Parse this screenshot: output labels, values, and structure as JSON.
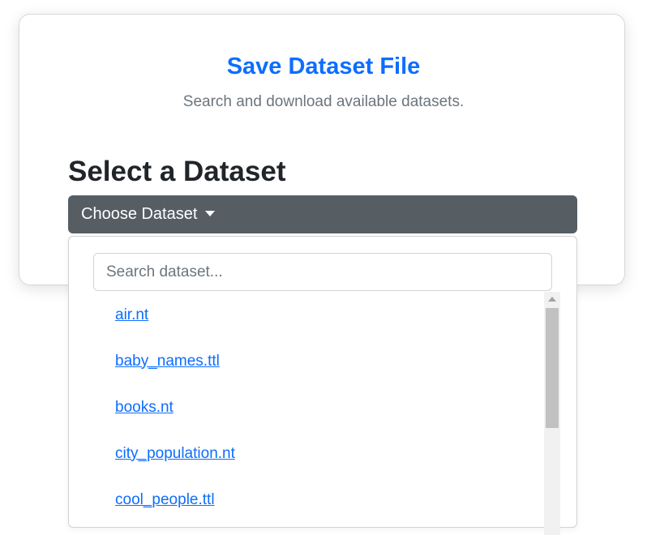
{
  "header": {
    "title": "Save Dataset File",
    "subtitle": "Search and download available datasets."
  },
  "section": {
    "heading": "Select a Dataset"
  },
  "dropdown": {
    "toggle_label": "Choose Dataset",
    "caret_icon": "caret-down-icon",
    "search": {
      "placeholder": "Search dataset...",
      "value": ""
    },
    "items": [
      {
        "label": "air.nt"
      },
      {
        "label": "baby_names.ttl"
      },
      {
        "label": "books.nt"
      },
      {
        "label": "city_population.nt"
      },
      {
        "label": "cool_people.ttl"
      }
    ]
  },
  "colors": {
    "accent": "#0d6efd",
    "toggle_bg": "#565e64",
    "link": "#0d6efd",
    "muted_text": "#6c757d"
  }
}
